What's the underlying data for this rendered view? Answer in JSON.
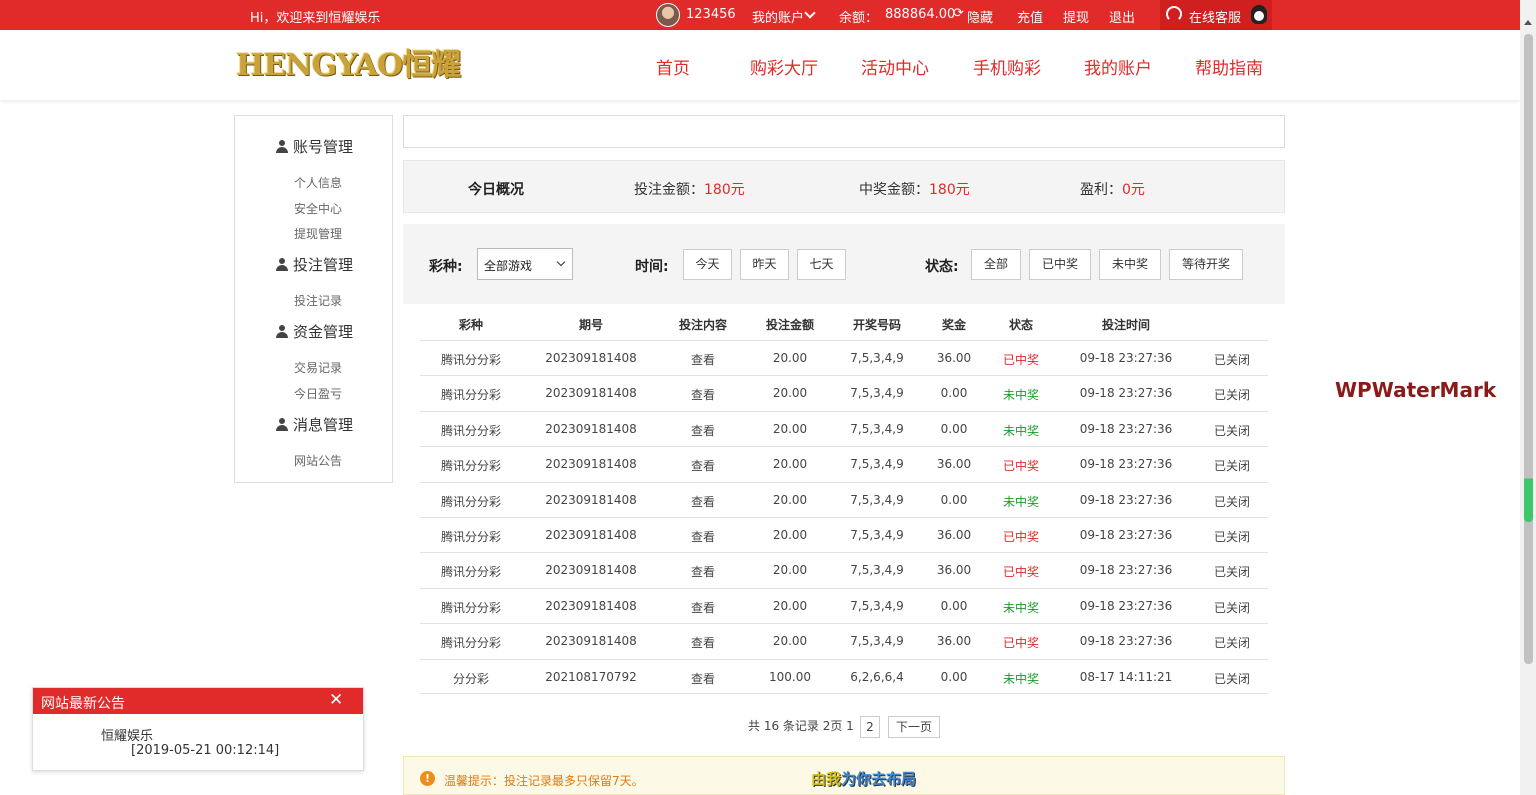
{
  "topbar": {
    "welcome": "Hi，欢迎来到恒耀娱乐",
    "username": "123456",
    "my_account": "我的账户",
    "balance_label": "余额：",
    "balance_value": "888864.00",
    "hide": "隐藏",
    "recharge": "充值",
    "withdraw": "提现",
    "logout": "退出",
    "customer_service": "在线客服"
  },
  "logo_text": "HENGYAO恒耀",
  "nav": [
    "首页",
    "购彩大厅",
    "活动中心",
    "手机购彩",
    "我的账户",
    "帮助指南"
  ],
  "sidebar": {
    "account_head": "账号管理",
    "account_items": [
      "个人信息",
      "安全中心",
      "提现管理"
    ],
    "bet_head": "投注管理",
    "bet_items": [
      "投注记录"
    ],
    "fund_head": "资金管理",
    "fund_items": [
      "交易记录",
      "今日盈亏"
    ],
    "msg_head": "消息管理",
    "msg_items": [
      "网站公告"
    ]
  },
  "overview": {
    "title": "今日概况",
    "bet_label": "投注金额：",
    "bet_value": "180元",
    "win_label": "中奖金额：",
    "win_value": "180元",
    "profit_label": "盈利：",
    "profit_value": "0元"
  },
  "filters": {
    "game_label": "彩种:",
    "game_selected": "全部游戏",
    "time_label": "时间:",
    "time_options": [
      "今天",
      "昨天",
      "七天"
    ],
    "status_label": "状态:",
    "status_options": [
      "全部",
      "已中奖",
      "未中奖",
      "等待开奖"
    ]
  },
  "table": {
    "headers": [
      "彩种",
      "期号",
      "投注内容",
      "投注金额",
      "开奖号码",
      "奖金",
      "状态",
      "投注时间"
    ],
    "rows": [
      {
        "game": "腾讯分分彩",
        "issue": "202309181408",
        "content": "查看",
        "amount": "20.00",
        "numbers": "7,5,3,4,9",
        "prize": "36.00",
        "status": "已中奖",
        "win": true,
        "time": "09-18 23:27:36",
        "state": "已关闭"
      },
      {
        "game": "腾讯分分彩",
        "issue": "202309181408",
        "content": "查看",
        "amount": "20.00",
        "numbers": "7,5,3,4,9",
        "prize": "0.00",
        "status": "未中奖",
        "win": false,
        "time": "09-18 23:27:36",
        "state": "已关闭"
      },
      {
        "game": "腾讯分分彩",
        "issue": "202309181408",
        "content": "查看",
        "amount": "20.00",
        "numbers": "7,5,3,4,9",
        "prize": "0.00",
        "status": "未中奖",
        "win": false,
        "time": "09-18 23:27:36",
        "state": "已关闭"
      },
      {
        "game": "腾讯分分彩",
        "issue": "202309181408",
        "content": "查看",
        "amount": "20.00",
        "numbers": "7,5,3,4,9",
        "prize": "36.00",
        "status": "已中奖",
        "win": true,
        "time": "09-18 23:27:36",
        "state": "已关闭"
      },
      {
        "game": "腾讯分分彩",
        "issue": "202309181408",
        "content": "查看",
        "amount": "20.00",
        "numbers": "7,5,3,4,9",
        "prize": "0.00",
        "status": "未中奖",
        "win": false,
        "time": "09-18 23:27:36",
        "state": "已关闭"
      },
      {
        "game": "腾讯分分彩",
        "issue": "202309181408",
        "content": "查看",
        "amount": "20.00",
        "numbers": "7,5,3,4,9",
        "prize": "36.00",
        "status": "已中奖",
        "win": true,
        "time": "09-18 23:27:36",
        "state": "已关闭"
      },
      {
        "game": "腾讯分分彩",
        "issue": "202309181408",
        "content": "查看",
        "amount": "20.00",
        "numbers": "7,5,3,4,9",
        "prize": "36.00",
        "status": "已中奖",
        "win": true,
        "time": "09-18 23:27:36",
        "state": "已关闭"
      },
      {
        "game": "腾讯分分彩",
        "issue": "202309181408",
        "content": "查看",
        "amount": "20.00",
        "numbers": "7,5,3,4,9",
        "prize": "0.00",
        "status": "未中奖",
        "win": false,
        "time": "09-18 23:27:36",
        "state": "已关闭"
      },
      {
        "game": "腾讯分分彩",
        "issue": "202309181408",
        "content": "查看",
        "amount": "20.00",
        "numbers": "7,5,3,4,9",
        "prize": "36.00",
        "status": "已中奖",
        "win": true,
        "time": "09-18 23:27:36",
        "state": "已关闭"
      },
      {
        "game": "分分彩",
        "issue": "202108170792",
        "content": "查看",
        "amount": "100.00",
        "numbers": "6,2,6,6,4",
        "prize": "0.00",
        "status": "未中奖",
        "win": false,
        "time": "08-17 14:11:21",
        "state": "已关闭"
      }
    ]
  },
  "pager": {
    "summary": "共 16 条记录 2页 1",
    "page2": "2",
    "next": "下一页"
  },
  "tip": {
    "text": "温馨提示：投注记录最多只保留7天。"
  },
  "overlay": {
    "part1": "由我",
    "part2": "为你去布局"
  },
  "watermark": "WPWaterMark",
  "notice": {
    "title": "网站最新公告",
    "item": "恒耀娱乐",
    "date": "[2019-05-21 00:12:14]"
  },
  "colors": {
    "brand_red": "#e12a2a",
    "win": "#e12a2a",
    "lose": "#1a9a2a",
    "tip_orange": "#e07a10"
  }
}
